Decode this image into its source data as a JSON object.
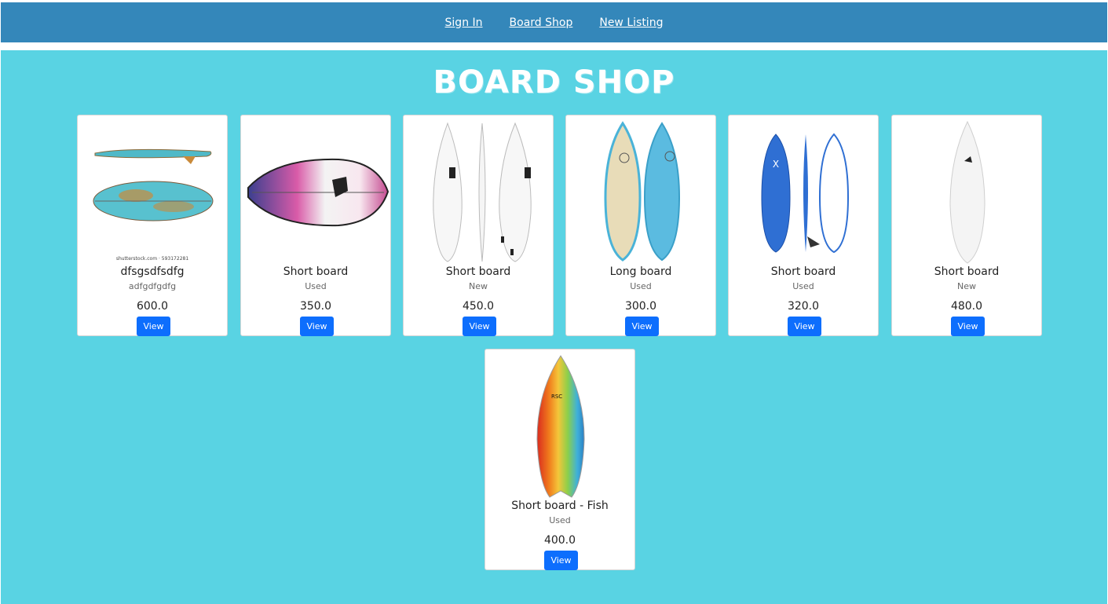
{
  "nav": {
    "items": [
      {
        "label": "Sign In"
      },
      {
        "label": "Board Shop"
      },
      {
        "label": "New Listing"
      }
    ]
  },
  "page": {
    "title": "BOARD SHOP"
  },
  "listings": [
    {
      "title": "dfsgsdfsdfg",
      "condition": "adfgdfgdfg",
      "price": "600.0",
      "button": "View",
      "image": "fish-board-top-side",
      "watermark": "shutterstock.com · 593172281"
    },
    {
      "title": "Short board",
      "condition": "Used",
      "price": "350.0",
      "button": "View",
      "image": "pink-skim-board"
    },
    {
      "title": "Short board",
      "condition": "New",
      "price": "450.0",
      "button": "View",
      "image": "white-shortboard-three-views"
    },
    {
      "title": "Long board",
      "condition": "Used",
      "price": "300.0",
      "button": "View",
      "image": "blue-longboard-two-views"
    },
    {
      "title": "Short board",
      "condition": "Used",
      "price": "320.0",
      "button": "View",
      "image": "blue-softboard-three-views"
    },
    {
      "title": "Short board",
      "condition": "New",
      "price": "480.0",
      "button": "View",
      "image": "white-shortboard"
    },
    {
      "title": "Short board - Fish",
      "condition": "Used",
      "price": "400.0",
      "button": "View",
      "image": "rainbow-fish-board"
    }
  ]
}
